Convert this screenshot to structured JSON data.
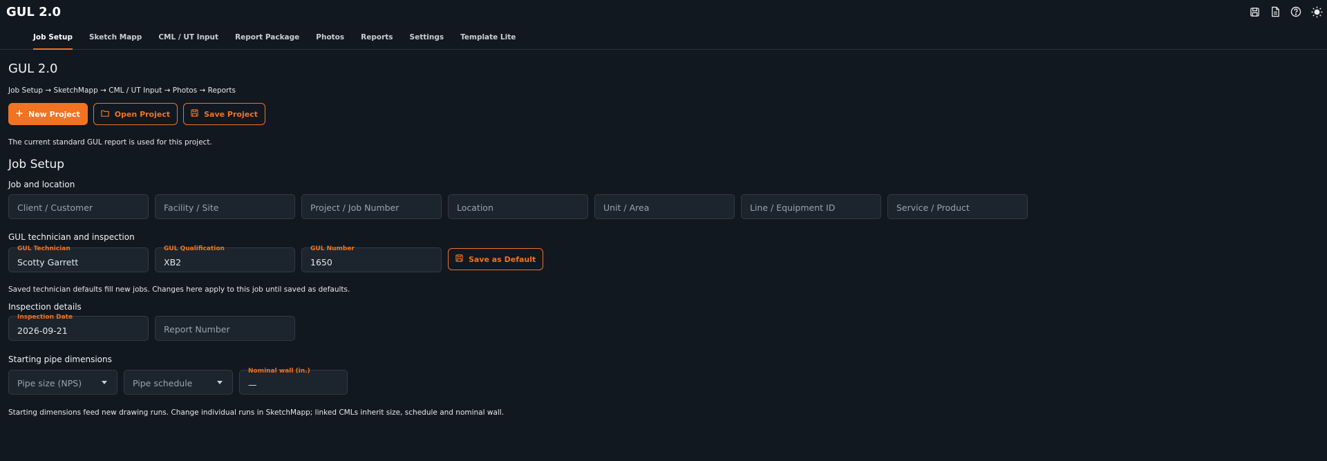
{
  "app": {
    "title": "GUL 2.0"
  },
  "tabs": [
    {
      "label": "Job Setup",
      "active": true
    },
    {
      "label": "Sketch Mapp"
    },
    {
      "label": "CML / UT Input"
    },
    {
      "label": "Report Package"
    },
    {
      "label": "Photos"
    },
    {
      "label": "Reports"
    },
    {
      "label": "Settings"
    },
    {
      "label": "Template Lite"
    }
  ],
  "page": {
    "title": "GUL 2.0",
    "breadcrumb": "Job Setup → SketchMapp → CML / UT Input → Photos → Reports",
    "buttons": {
      "new_project": "New Project",
      "open_project": "Open Project",
      "save_project": "Save Project"
    },
    "report_note": "The current standard GUL report is used for this project."
  },
  "job_setup": {
    "title": "Job Setup",
    "job_location": {
      "title": "Job and location",
      "fields": [
        {
          "placeholder": "Client / Customer"
        },
        {
          "placeholder": "Facility / Site"
        },
        {
          "placeholder": "Project / Job Number"
        },
        {
          "placeholder": "Location"
        },
        {
          "placeholder": "Unit / Area"
        },
        {
          "placeholder": "Line / Equipment ID"
        },
        {
          "placeholder": "Service / Product"
        }
      ]
    },
    "technician": {
      "title": "GUL technician and inspection",
      "tech_label": "GUL Technician",
      "tech_value": "Scotty Garrett",
      "qual_label": "GUL Qualification",
      "qual_value": "XB2",
      "num_label": "GUL Number",
      "num_value": "1650",
      "save_default": "Save as Default",
      "note": "Saved technician defaults fill new jobs. Changes here apply to this job until saved as defaults."
    },
    "inspection": {
      "title": "Inspection details",
      "date_label": "Inspection Date",
      "date_value": "2026-09-21",
      "report_placeholder": "Report Number"
    },
    "pipe": {
      "title": "Starting pipe dimensions",
      "size_placeholder": "Pipe size (NPS)",
      "schedule_placeholder": "Pipe schedule",
      "wall_label": "Nominal wall (in.)",
      "wall_value": "—",
      "note": "Starting dimensions feed new drawing runs. Change individual runs in SketchMapp; linked CMLs inherit size, schedule and nominal wall."
    }
  },
  "colors": {
    "accent": "#f27321",
    "background": "#121820",
    "field": "#1c242d"
  },
  "icons": [
    "save-icon",
    "document-icon",
    "help-icon",
    "sun-icon",
    "plus-icon",
    "folder-icon"
  ]
}
